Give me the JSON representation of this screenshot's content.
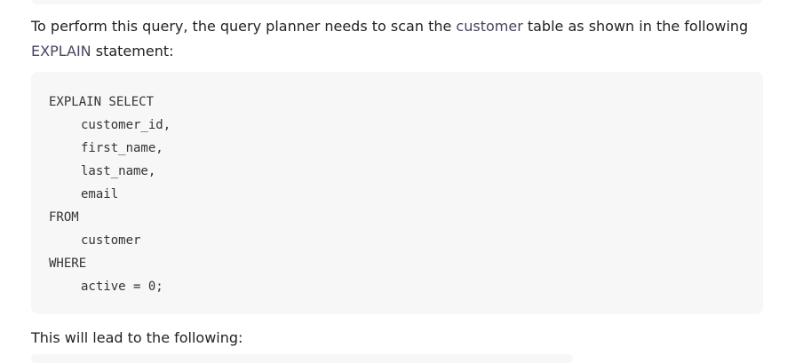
{
  "intro": {
    "text_before": "To perform this query, the query planner needs to scan the ",
    "inline_code": "customer",
    "text_after": " table as shown in the following ",
    "line2_code": "EXPLAIN",
    "line2_after": " statement:"
  },
  "code": {
    "lines": [
      "EXPLAIN SELECT",
      "customer_id,",
      "first_name,",
      "last_name,",
      "email",
      "FROM",
      "customer",
      "WHERE",
      "active = 0;"
    ]
  },
  "outro": {
    "text": "This will lead to the following:"
  }
}
